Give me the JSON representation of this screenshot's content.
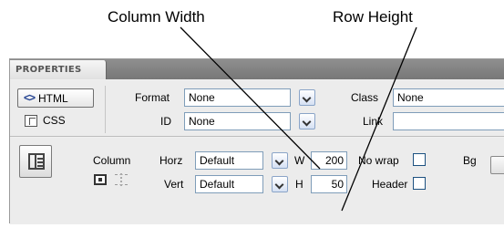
{
  "callouts": {
    "column_width": "Column Width",
    "row_height": "Row Height"
  },
  "panel": {
    "tab_label": "PROPERTIES",
    "html_button": "HTML",
    "css_button": "CSS",
    "format": {
      "label": "Format",
      "value": "None"
    },
    "id": {
      "label": "ID",
      "value": "None"
    },
    "class": {
      "label": "Class",
      "value": "None"
    },
    "link": {
      "label": "Link",
      "value": ""
    }
  },
  "cell": {
    "type_label": "Column",
    "horz": {
      "label": "Horz",
      "value": "Default"
    },
    "vert": {
      "label": "Vert",
      "value": "Default"
    },
    "width": {
      "label": "W",
      "value": "200"
    },
    "height": {
      "label": "H",
      "value": "50"
    },
    "no_wrap_label": "No wrap",
    "header_label": "Header",
    "bg_label": "Bg"
  },
  "icons": [
    "html-tag-icon",
    "css-icon",
    "cell-properties-icon",
    "merge-cells-icon",
    "split-cell-icon",
    "color-picker-icon"
  ],
  "colors": {
    "titlebar": "#808080",
    "panel_bg": "#ececec",
    "input_border": "#7f9db9"
  }
}
